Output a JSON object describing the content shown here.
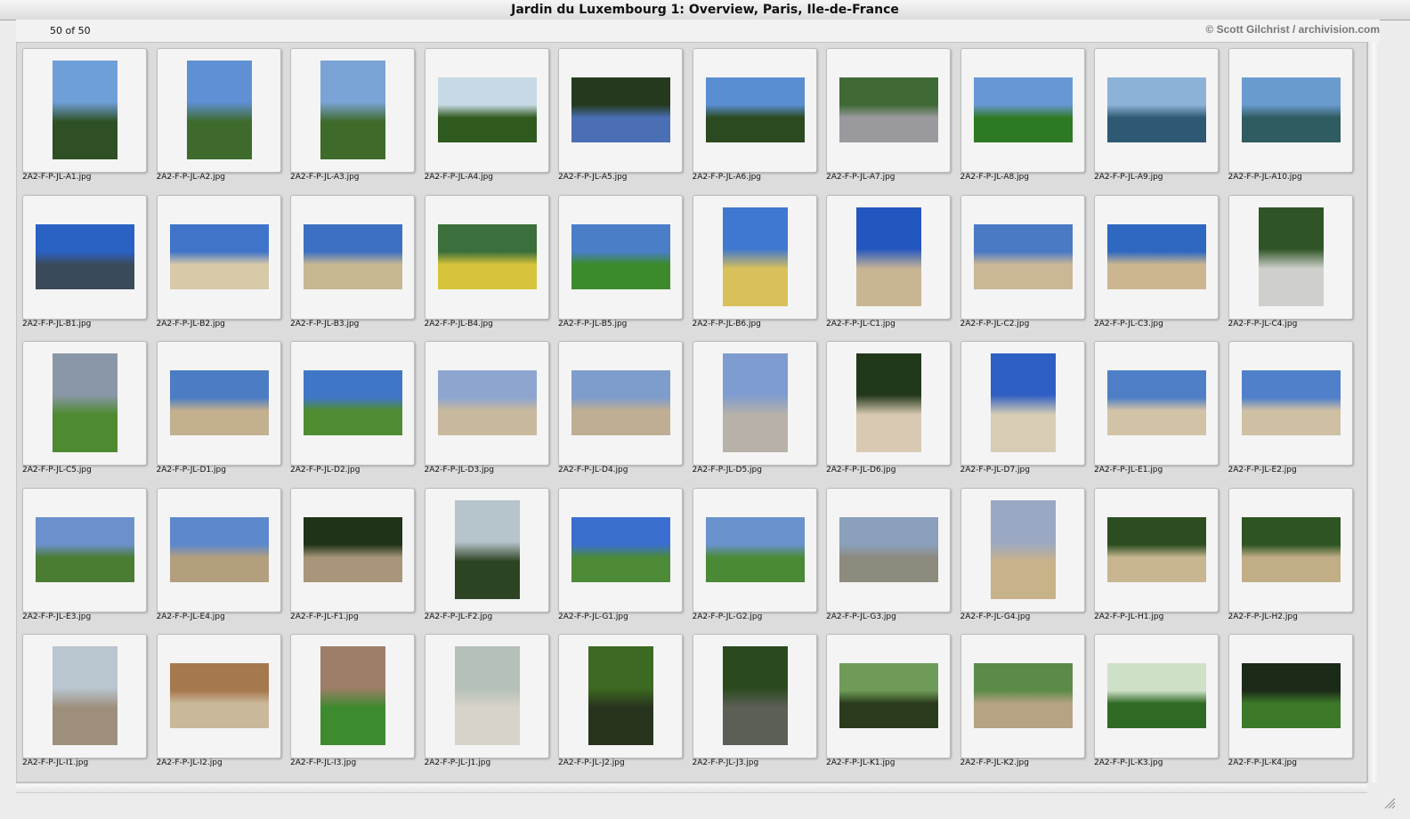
{
  "window": {
    "title": "Jardin du Luxembourg 1: Overview, Paris, Ile-de-France"
  },
  "toolbar": {
    "count": "50 of 50",
    "credit": "© Scott Gilchrist / archivision.com"
  },
  "thumbnails": [
    {
      "file": "2A2-F-P-JL-A1.jpg",
      "orientation": "portrait",
      "colors": [
        "#6f9fd8",
        "#2f4f24"
      ]
    },
    {
      "file": "2A2-F-P-JL-A2.jpg",
      "orientation": "portrait",
      "colors": [
        "#5f8fd4",
        "#3e6b2c"
      ]
    },
    {
      "file": "2A2-F-P-JL-A3.jpg",
      "orientation": "portrait",
      "colors": [
        "#7aa3d6",
        "#3e6a2a"
      ]
    },
    {
      "file": "2A2-F-P-JL-A4.jpg",
      "orientation": "landscape",
      "colors": [
        "#c6d9e4",
        "#2f5a1e"
      ]
    },
    {
      "file": "2A2-F-P-JL-A5.jpg",
      "orientation": "landscape",
      "colors": [
        "#24391d",
        "#4b6fb5"
      ]
    },
    {
      "file": "2A2-F-P-JL-A6.jpg",
      "orientation": "landscape",
      "colors": [
        "#5a8ed1",
        "#2b4a1f"
      ]
    },
    {
      "file": "2A2-F-P-JL-A7.jpg",
      "orientation": "landscape",
      "colors": [
        "#3f6a36",
        "#9a9a9e"
      ]
    },
    {
      "file": "2A2-F-P-JL-A8.jpg",
      "orientation": "landscape",
      "colors": [
        "#6898d4",
        "#2e7a24"
      ]
    },
    {
      "file": "2A2-F-P-JL-A9.jpg",
      "orientation": "landscape",
      "colors": [
        "#8db2d8",
        "#2d5a72"
      ]
    },
    {
      "file": "2A2-F-P-JL-A10.jpg",
      "orientation": "landscape",
      "colors": [
        "#6a9bcf",
        "#2f5c60"
      ]
    },
    {
      "file": "2A2-F-P-JL-B1.jpg",
      "orientation": "landscape",
      "colors": [
        "#2a62c4",
        "#3b4a5a"
      ]
    },
    {
      "file": "2A2-F-P-JL-B2.jpg",
      "orientation": "landscape",
      "colors": [
        "#3f74c8",
        "#d8c9a8"
      ]
    },
    {
      "file": "2A2-F-P-JL-B3.jpg",
      "orientation": "landscape",
      "colors": [
        "#3d70c2",
        "#c8b891"
      ]
    },
    {
      "file": "2A2-F-P-JL-B4.jpg",
      "orientation": "landscape",
      "colors": [
        "#3b6f3b",
        "#d6c43a"
      ]
    },
    {
      "file": "2A2-F-P-JL-B5.jpg",
      "orientation": "landscape",
      "colors": [
        "#4a7ec8",
        "#3c8a2a"
      ]
    },
    {
      "file": "2A2-F-P-JL-B6.jpg",
      "orientation": "portrait",
      "colors": [
        "#3f78d0",
        "#d8c05a"
      ]
    },
    {
      "file": "2A2-F-P-JL-C1.jpg",
      "orientation": "portrait",
      "colors": [
        "#2456c0",
        "#c8b594"
      ]
    },
    {
      "file": "2A2-F-P-JL-C2.jpg",
      "orientation": "landscape",
      "colors": [
        "#4a7ac4",
        "#c9b796"
      ]
    },
    {
      "file": "2A2-F-P-JL-C3.jpg",
      "orientation": "landscape",
      "colors": [
        "#2f68c0",
        "#cbb690"
      ]
    },
    {
      "file": "2A2-F-P-JL-C4.jpg",
      "orientation": "portrait",
      "colors": [
        "#2f5526",
        "#cfd0cc"
      ]
    },
    {
      "file": "2A2-F-P-JL-C5.jpg",
      "orientation": "portrait",
      "colors": [
        "#8a97a8",
        "#4e8a30"
      ]
    },
    {
      "file": "2A2-F-P-JL-D1.jpg",
      "orientation": "landscape",
      "colors": [
        "#4b7cc4",
        "#c2b08f"
      ]
    },
    {
      "file": "2A2-F-P-JL-D2.jpg",
      "orientation": "landscape",
      "colors": [
        "#4076c6",
        "#4f8c32"
      ]
    },
    {
      "file": "2A2-F-P-JL-D3.jpg",
      "orientation": "landscape",
      "colors": [
        "#8ea6cf",
        "#c8b99e"
      ]
    },
    {
      "file": "2A2-F-P-JL-D4.jpg",
      "orientation": "landscape",
      "colors": [
        "#7e9ccc",
        "#bfae93"
      ]
    },
    {
      "file": "2A2-F-P-JL-D5.jpg",
      "orientation": "portrait",
      "colors": [
        "#7f9cd0",
        "#b7b1a8"
      ]
    },
    {
      "file": "2A2-F-P-JL-D6.jpg",
      "orientation": "portrait",
      "colors": [
        "#22381a",
        "#d9c9b2"
      ]
    },
    {
      "file": "2A2-F-P-JL-D7.jpg",
      "orientation": "portrait",
      "colors": [
        "#2e5fc4",
        "#d8ccb4"
      ]
    },
    {
      "file": "2A2-F-P-JL-E1.jpg",
      "orientation": "landscape",
      "colors": [
        "#4e7fc6",
        "#d3c3a6"
      ]
    },
    {
      "file": "2A2-F-P-JL-E2.jpg",
      "orientation": "landscape",
      "colors": [
        "#4f80c9",
        "#cfc0a4"
      ]
    },
    {
      "file": "2A2-F-P-JL-E3.jpg",
      "orientation": "landscape",
      "colors": [
        "#6b91cc",
        "#4a7c32"
      ]
    },
    {
      "file": "2A2-F-P-JL-E4.jpg",
      "orientation": "landscape",
      "colors": [
        "#5d88cc",
        "#b39f7e"
      ]
    },
    {
      "file": "2A2-F-P-JL-F1.jpg",
      "orientation": "landscape",
      "colors": [
        "#1e3318",
        "#a8957a"
      ]
    },
    {
      "file": "2A2-F-P-JL-F2.jpg",
      "orientation": "portrait",
      "colors": [
        "#b6c4cc",
        "#2d4422"
      ]
    },
    {
      "file": "2A2-F-P-JL-G1.jpg",
      "orientation": "landscape",
      "colors": [
        "#3a6fd0",
        "#4c8a38"
      ]
    },
    {
      "file": "2A2-F-P-JL-G2.jpg",
      "orientation": "landscape",
      "colors": [
        "#6a92cc",
        "#4a8a36"
      ]
    },
    {
      "file": "2A2-F-P-JL-G3.jpg",
      "orientation": "landscape",
      "colors": [
        "#8aa0bc",
        "#8d8a7e"
      ]
    },
    {
      "file": "2A2-F-P-JL-G4.jpg",
      "orientation": "portrait",
      "colors": [
        "#9aa8c4",
        "#c8b28a"
      ]
    },
    {
      "file": "2A2-F-P-JL-H1.jpg",
      "orientation": "landscape",
      "colors": [
        "#2b4d20",
        "#c8b690"
      ]
    },
    {
      "file": "2A2-F-P-JL-H2.jpg",
      "orientation": "landscape",
      "colors": [
        "#2d5422",
        "#c2ae86"
      ]
    },
    {
      "file": "2A2-F-P-JL-I1.jpg",
      "orientation": "portrait",
      "colors": [
        "#b9c6d0",
        "#9e8f7c"
      ]
    },
    {
      "file": "2A2-F-P-JL-I2.jpg",
      "orientation": "landscape",
      "colors": [
        "#a6784e",
        "#cab89a"
      ]
    },
    {
      "file": "2A2-F-P-JL-I3.jpg",
      "orientation": "portrait",
      "colors": [
        "#9e7e68",
        "#3e8a2e"
      ]
    },
    {
      "file": "2A2-F-P-JL-J1.jpg",
      "orientation": "portrait",
      "colors": [
        "#b4c0b8",
        "#d7d3c8"
      ]
    },
    {
      "file": "2A2-F-P-JL-J2.jpg",
      "orientation": "portrait",
      "colors": [
        "#3d6a22",
        "#28331e"
      ]
    },
    {
      "file": "2A2-F-P-JL-J3.jpg",
      "orientation": "portrait",
      "colors": [
        "#2a4a1e",
        "#5c5f56"
      ]
    },
    {
      "file": "2A2-F-P-JL-K1.jpg",
      "orientation": "landscape",
      "colors": [
        "#6e9c58",
        "#2a3a1c"
      ]
    },
    {
      "file": "2A2-F-P-JL-K2.jpg",
      "orientation": "landscape",
      "colors": [
        "#5c8a48",
        "#b6a384"
      ]
    },
    {
      "file": "2A2-F-P-JL-K3.jpg",
      "orientation": "landscape",
      "colors": [
        "#cfe0c8",
        "#2f6a24"
      ]
    },
    {
      "file": "2A2-F-P-JL-K4.jpg",
      "orientation": "landscape",
      "colors": [
        "#1c2a18",
        "#3c7a2a"
      ]
    }
  ]
}
